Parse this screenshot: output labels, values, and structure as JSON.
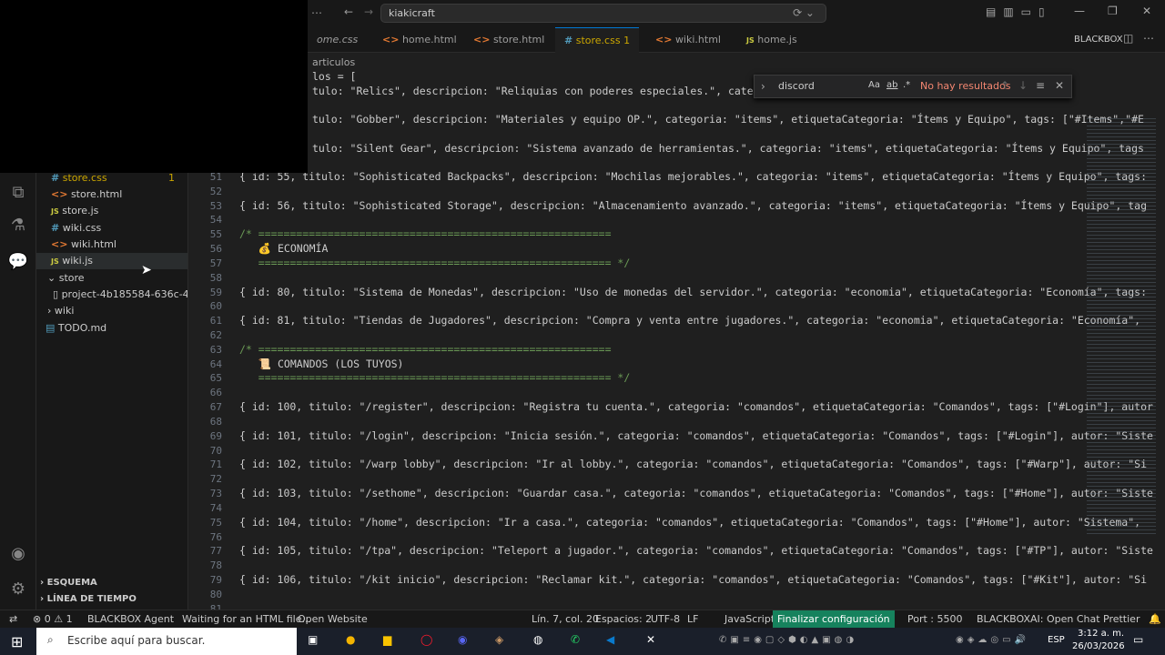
{
  "titlebar": {
    "search": "kiakicraft"
  },
  "tabs": [
    {
      "label": "ome.css"
    },
    {
      "label": "home.html"
    },
    {
      "label": "store.html"
    },
    {
      "label": "store.css",
      "badge": "1"
    },
    {
      "label": "wiki.html"
    },
    {
      "label": "home.js"
    }
  ],
  "panel_label": "BLACKBOX",
  "breadcrumb": "articulos",
  "find": {
    "value": "discord",
    "opts": [
      "Aa",
      "ab",
      ".*"
    ],
    "result": "No hay resultados"
  },
  "explorer": {
    "files": [
      {
        "name": "store.css",
        "badge": "1"
      },
      {
        "name": "store.html"
      },
      {
        "name": "store.js"
      },
      {
        "name": "wiki.css"
      },
      {
        "name": "wiki.html"
      },
      {
        "name": "wiki.js"
      }
    ],
    "folders": [
      {
        "name": "store"
      },
      {
        "name": "project-4b185584-636c-4..."
      },
      {
        "name": "wiki"
      },
      {
        "name": "TODO.md"
      }
    ],
    "sections": [
      "ESQUEMA",
      "LÍNEA DE TIEMPO"
    ]
  },
  "code": {
    "top": [
      "los = [",
      "tulo: \"Relics\", descripcion: \"Reliquias con poderes especiales.\", categoria:",
      "tulo: \"Gobber\", descripcion: \"Materiales y equipo OP.\", categoria: \"items\", etiquetaCategoria: \"Ítems y Equipo\", tags: [\"#Items\",\"#E",
      "tulo: \"Silent Gear\", descripcion: \"Sistema avanzado de herramientas.\", categoria: \"items\", etiquetaCategoria: \"Ítems y Equipo\", tags"
    ],
    "lines": [
      {
        "n": "51",
        "t": "{ id: 55, titulo: \"Sophisticated Backpacks\", descripcion: \"Mochilas mejorables.\", categoria: \"items\", etiquetaCategoria: \"Ítems y Equipo\", tags:"
      },
      {
        "n": "52",
        "t": ""
      },
      {
        "n": "53",
        "t": "{ id: 56, titulo: \"Sophisticated Storage\", descripcion: \"Almacenamiento avanzado.\", categoria: \"items\", etiquetaCategoria: \"Ítems y Equipo\", tag"
      },
      {
        "n": "54",
        "t": ""
      },
      {
        "n": "55",
        "t": "/* ========================================================"
      },
      {
        "n": "56",
        "t": "   💰 ECONOMÍA"
      },
      {
        "n": "57",
        "t": "   ======================================================== */"
      },
      {
        "n": "58",
        "t": ""
      },
      {
        "n": "59",
        "t": "{ id: 80, titulo: \"Sistema de Monedas\", descripcion: \"Uso de monedas del servidor.\", categoria: \"economia\", etiquetaCategoria: \"Economía\", tags:"
      },
      {
        "n": "60",
        "t": ""
      },
      {
        "n": "61",
        "t": "{ id: 81, titulo: \"Tiendas de Jugadores\", descripcion: \"Compra y venta entre jugadores.\", categoria: \"economia\", etiquetaCategoria: \"Economía\","
      },
      {
        "n": "62",
        "t": ""
      },
      {
        "n": "63",
        "t": "/* ========================================================"
      },
      {
        "n": "64",
        "t": "   📜 COMANDOS (LOS TUYOS)"
      },
      {
        "n": "65",
        "t": "   ======================================================== */"
      },
      {
        "n": "66",
        "t": ""
      },
      {
        "n": "67",
        "t": "{ id: 100, titulo: \"/register\", descripcion: \"Registra tu cuenta.\", categoria: \"comandos\", etiquetaCategoria: \"Comandos\", tags: [\"#Login\"], autor"
      },
      {
        "n": "68",
        "t": ""
      },
      {
        "n": "69",
        "t": "{ id: 101, titulo: \"/login\", descripcion: \"Inicia sesión.\", categoria: \"comandos\", etiquetaCategoria: \"Comandos\", tags: [\"#Login\"], autor: \"Siste"
      },
      {
        "n": "70",
        "t": ""
      },
      {
        "n": "71",
        "t": "{ id: 102, titulo: \"/warp lobby\", descripcion: \"Ir al lobby.\", categoria: \"comandos\", etiquetaCategoria: \"Comandos\", tags: [\"#Warp\"], autor: \"Si"
      },
      {
        "n": "72",
        "t": ""
      },
      {
        "n": "73",
        "t": "{ id: 103, titulo: \"/sethome\", descripcion: \"Guardar casa.\", categoria: \"comandos\", etiquetaCategoria: \"Comandos\", tags: [\"#Home\"], autor: \"Siste"
      },
      {
        "n": "74",
        "t": ""
      },
      {
        "n": "75",
        "t": "{ id: 104, titulo: \"/home\", descripcion: \"Ir a casa.\", categoria: \"comandos\", etiquetaCategoria: \"Comandos\", tags: [\"#Home\"], autor: \"Sistema\","
      },
      {
        "n": "76",
        "t": ""
      },
      {
        "n": "77",
        "t": "{ id: 105, titulo: \"/tpa\", descripcion: \"Teleport a jugador.\", categoria: \"comandos\", etiquetaCategoria: \"Comandos\", tags: [\"#TP\"], autor: \"Siste"
      },
      {
        "n": "78",
        "t": ""
      },
      {
        "n": "79",
        "t": "{ id: 106, titulo: \"/kit inicio\", descripcion: \"Reclamar kit.\", categoria: \"comandos\", etiquetaCategoria: \"Comandos\", tags: [\"#Kit\"], autor: \"Si"
      },
      {
        "n": "80",
        "t": ""
      },
      {
        "n": "81",
        "t": ""
      }
    ]
  },
  "statusbar": {
    "errors": "⊗ 0 ⚠ 1",
    "agent": "BLACKBOX Agent",
    "waiting": "Waiting for an HTML file...",
    "open": "Open Website",
    "pos": "Lín. 7, col. 20",
    "spaces": "Espacios: 2",
    "enc": "UTF-8",
    "eol": "LF",
    "lang": "JavaScript",
    "finalize": "Finalizar configuración",
    "port": "Port : 5500",
    "chat": "BLACKBOXAI: Open Chat",
    "prettier": "Prettier"
  },
  "taskbar": {
    "search": "Escribe aquí para buscar.",
    "time": "3:12 a. m.",
    "date": "26/03/2026",
    "lang": "ESP"
  },
  "colors": {
    "accent": "#0078d4",
    "finalize_bg": "#16825d"
  }
}
